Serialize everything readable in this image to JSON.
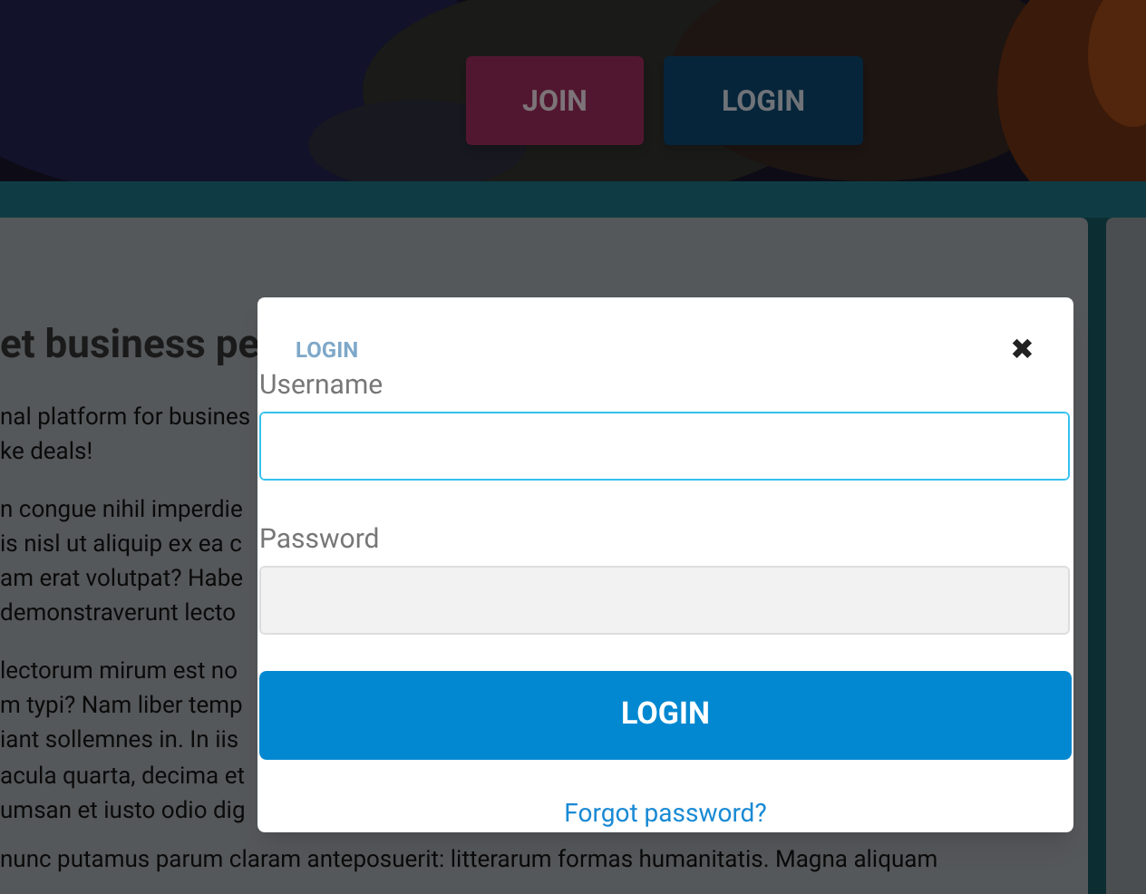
{
  "header": {
    "buttons": [
      {
        "label": "JOIN",
        "kind": "join"
      },
      {
        "label": "LOGIN",
        "kind": "login"
      }
    ]
  },
  "article": {
    "heading": "et business pe",
    "paragraphs": [
      "nal platform for busines\nke deals!",
      "n congue nihil imperdie\nis nisl ut aliquip ex ea c\nam erat volutpat? Habe\ndemonstraverunt lecto",
      "lectorum mirum est no\nm typi? Nam liber temp\niant sollemnes in. In iis\nacula quarta, decima et\numsan et iusto odio dig",
      "nunc putamus parum claram anteposuerit: litterarum formas humanitatis. Magna aliquam"
    ]
  },
  "modal": {
    "title": "LOGIN",
    "close": "✖",
    "fields": [
      {
        "label": "Username",
        "focused": true
      },
      {
        "label": "Password",
        "focused": false
      }
    ],
    "submit": "LOGIN",
    "link": "Forgot password?"
  }
}
